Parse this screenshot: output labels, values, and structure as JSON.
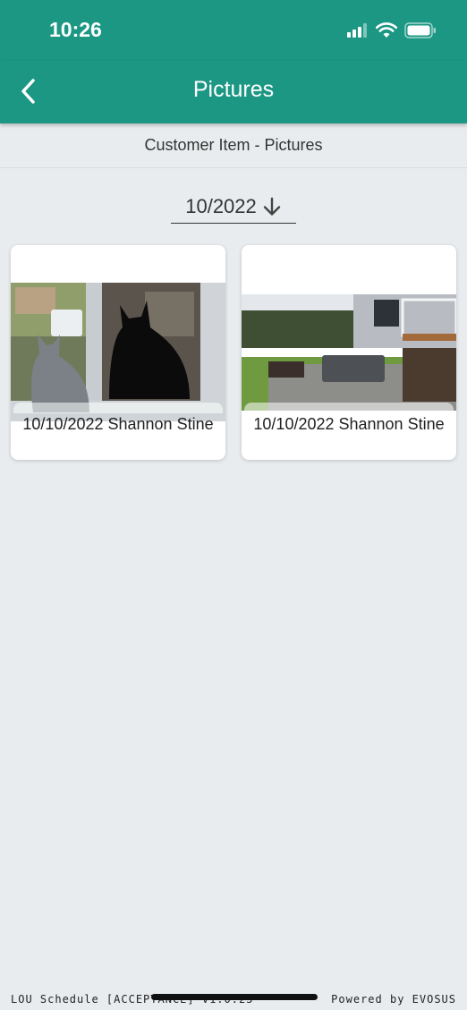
{
  "status_bar": {
    "time": "10:26"
  },
  "header": {
    "title": "Pictures",
    "back_icon": "chevron-left-icon"
  },
  "subheader": {
    "title": "Customer Item - Pictures"
  },
  "date_filter": {
    "value": "10/2022",
    "sort_icon": "arrow-down-icon"
  },
  "pictures": [
    {
      "caption": "10/10/2022 Shannon Stine"
    },
    {
      "caption": "10/10/2022 Shannon Stine"
    }
  ],
  "footer": {
    "left": "LOU Schedule [ACCEPTANCE] v1.0.25",
    "right": "Powered by EVOSUS"
  },
  "colors": {
    "brand": "#1b9784",
    "background": "#e9ecef"
  }
}
